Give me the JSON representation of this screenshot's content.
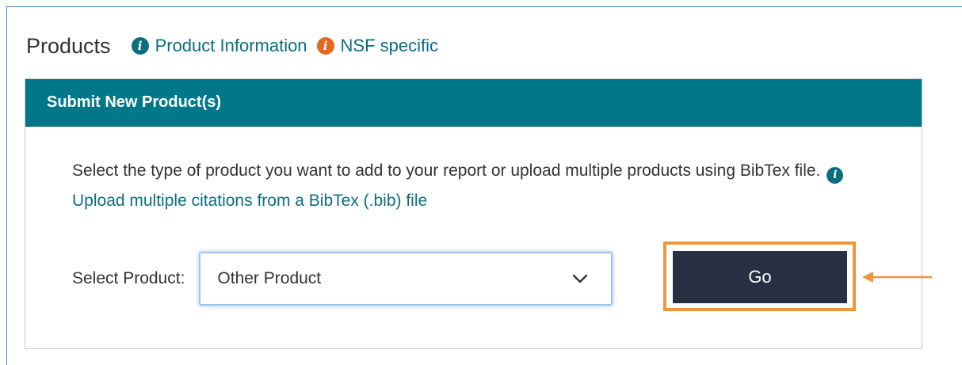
{
  "header": {
    "title": "Products",
    "info_link_label": "Product Information",
    "nsf_link_label": "NSF specific"
  },
  "panel": {
    "title": "Submit New Product(s)",
    "description_prefix": "Select the type of product you want to add to your report or upload multiple products using BibTex file.",
    "upload_link_label": "Upload multiple citations from a BibTex (.bib) file",
    "select_label": "Select Product:",
    "select_value": "Other Product",
    "go_label": "Go"
  },
  "icons": {
    "info": "info-circle-icon",
    "chevron": "chevron-down-icon",
    "arrow": "arrow-left-icon"
  },
  "colors": {
    "teal": "#00788a",
    "link": "#0b6e7f",
    "orange": "#e5681b",
    "highlight": "#f0953f",
    "button": "#283044"
  }
}
